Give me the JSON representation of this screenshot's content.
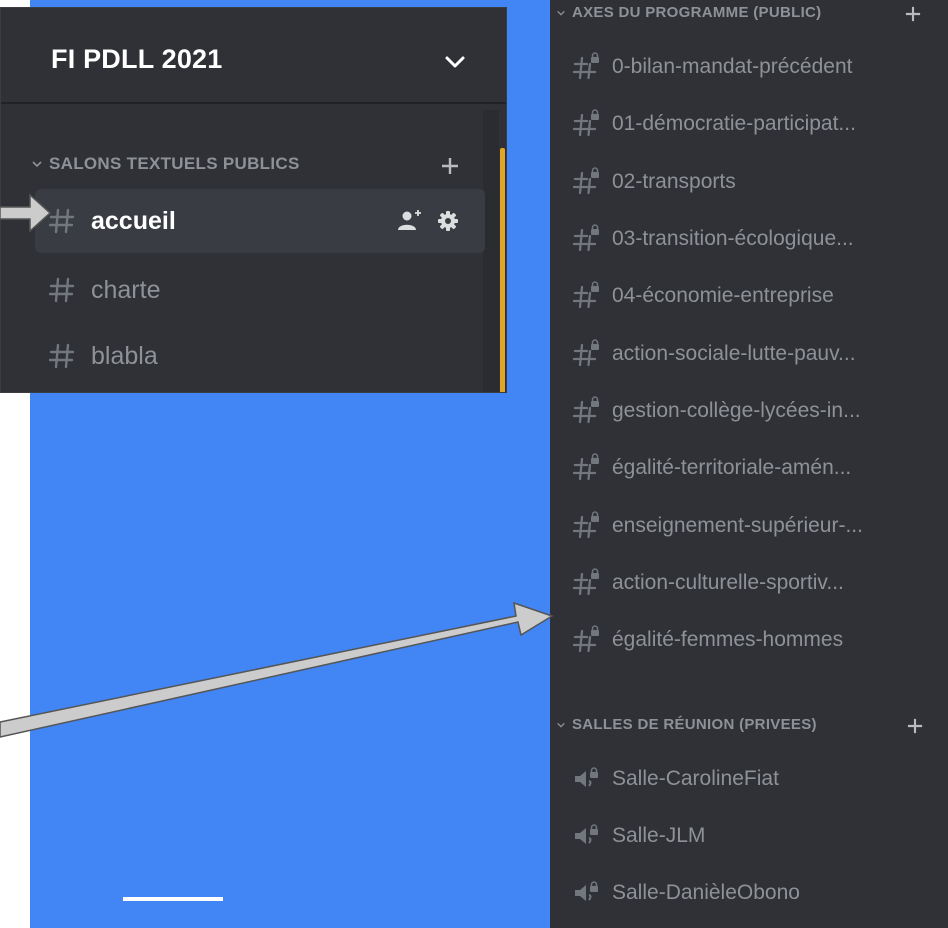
{
  "server": {
    "name": "FI PDLL 2021"
  },
  "left_category": {
    "label": "SALONS TEXTUELS PUBLICS"
  },
  "left_channels": [
    {
      "label": "accueil"
    },
    {
      "label": "charte"
    },
    {
      "label": "blabla"
    }
  ],
  "right_categories": [
    {
      "label": "AXES DU PROGRAMME (PUBLIC)"
    },
    {
      "label": "SALLES DE RÉUNION (PRIVEES)"
    }
  ],
  "program_channels": [
    {
      "label": "0-bilan-mandat-précédent"
    },
    {
      "label": "01-démocratie-participat..."
    },
    {
      "label": "02-transports"
    },
    {
      "label": "03-transition-écologique..."
    },
    {
      "label": "04-économie-entreprise"
    },
    {
      "label": "action-sociale-lutte-pauv..."
    },
    {
      "label": "gestion-collège-lycées-in..."
    },
    {
      "label": "égalité-territoriale-amén..."
    },
    {
      "label": "enseignement-supérieur-..."
    },
    {
      "label": "action-culturelle-sportiv..."
    },
    {
      "label": "égalité-femmes-hommes"
    }
  ],
  "voice_channels": [
    {
      "label": "Salle-CarolineFiat"
    },
    {
      "label": "Salle-JLM"
    },
    {
      "label": "Salle-DanièleObono"
    }
  ],
  "colors": {
    "background_blue": "#4285f4",
    "sidebar": "#2f3136",
    "selected_row": "#393c43",
    "muted_text": "#8e9297",
    "scroll_accent": "#e2a526",
    "annotation_arrow": "#cccccc"
  }
}
